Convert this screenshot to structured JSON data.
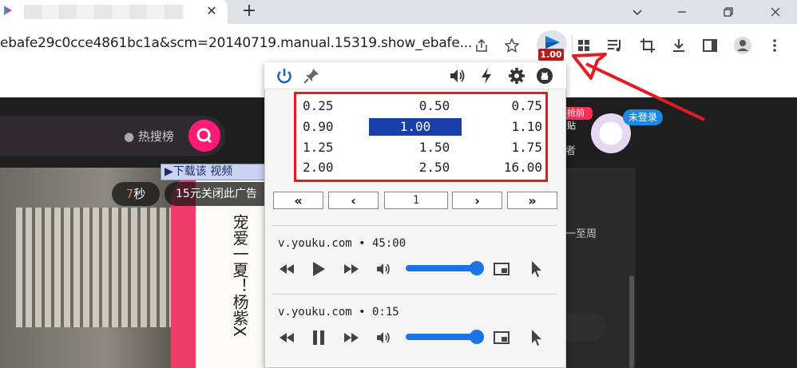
{
  "browser": {
    "tab_close_glyph": "✕",
    "new_tab_glyph": "+",
    "url": "ebafe29c0cce4861bc1a&scm=20140719.manual.15319.show_ebafe...",
    "extension_badge": "1.00"
  },
  "page": {
    "hot_search_label": "热搜榜",
    "download_banner": "▶下载该 视频",
    "timer_number": "7",
    "timer_unit": "秒",
    "close_ad": "15元关闭此广告",
    "vertical_text": "宠爱一夏！杨紫X",
    "login_badge": "未登录",
    "red_tag": "抢前贴",
    "right_text_1": "一至周",
    "right_text_2": "者"
  },
  "popup": {
    "speeds": [
      [
        "0.25",
        "0.50",
        "0.75"
      ],
      [
        "0.90",
        "1.00",
        "1.10"
      ],
      [
        "1.25",
        "1.50",
        "1.75"
      ],
      [
        "2.00",
        "2.50",
        "16.00"
      ]
    ],
    "active_speed": "1.00",
    "page_number": "1",
    "nav": {
      "first": "«",
      "prev": "‹",
      "next": "›",
      "last": "»"
    },
    "media": [
      {
        "title": "v.youku.com • 45:00",
        "state": "paused",
        "volume": 1.0
      },
      {
        "title": "v.youku.com • 0:15",
        "state": "playing",
        "volume": 1.0
      }
    ]
  },
  "colors": {
    "highlight_red": "#e31b23",
    "active_speed_bg": "#1a3fa8",
    "slider_blue": "#1a73e8",
    "power_blue": "#1565c0"
  }
}
